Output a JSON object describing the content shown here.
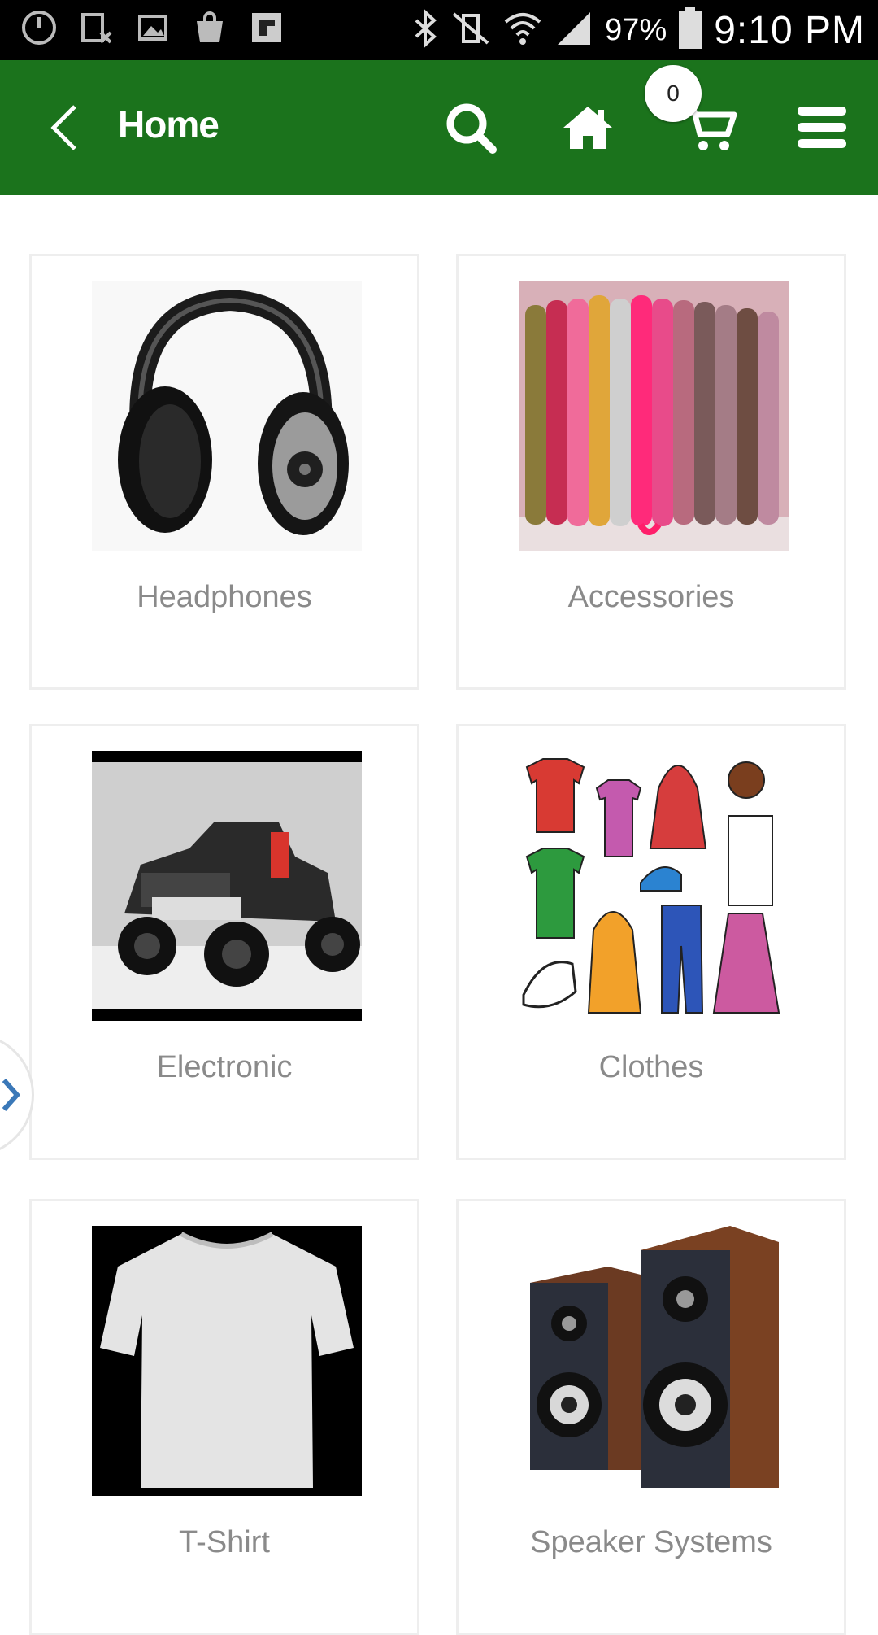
{
  "status_bar": {
    "battery": "97%",
    "time": "9:10 PM"
  },
  "app_bar": {
    "title": "Home",
    "cart_count": "0"
  },
  "categories": [
    {
      "label": "Headphones",
      "icon": "headphones-image"
    },
    {
      "label": "Accessories",
      "icon": "bracelets-image"
    },
    {
      "label": "Electronic",
      "icon": "jeep-image"
    },
    {
      "label": "Clothes",
      "icon": "clothes-image"
    },
    {
      "label": "T-Shirt",
      "icon": "tshirt-image"
    },
    {
      "label": "Speaker Systems",
      "icon": "speakers-image"
    }
  ],
  "colors": {
    "app_bar": "#1b731c",
    "status_bar": "#000000",
    "label_text": "#8a8a8a",
    "card_border": "#eeeeee"
  }
}
